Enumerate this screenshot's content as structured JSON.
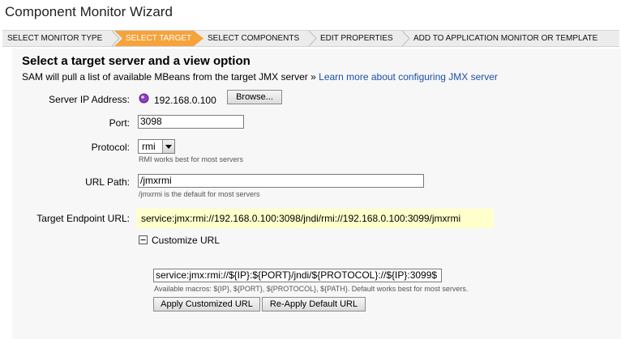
{
  "page": {
    "title": "Component Monitor Wizard"
  },
  "wizard": {
    "steps": [
      {
        "label": "SELECT MONITOR TYPE",
        "active": false
      },
      {
        "label": "SELECT TARGET",
        "active": true
      },
      {
        "label": "SELECT COMPONENTS",
        "active": false
      },
      {
        "label": "EDIT PROPERTIES",
        "active": false
      },
      {
        "label": "ADD TO APPLICATION MONITOR OR TEMPLATE",
        "active": false
      }
    ],
    "active_color": "#f5a33a"
  },
  "section": {
    "heading": "Select a target server and a view option",
    "description": "SAM will pull a list of available MBeans from the target JMX server »",
    "link": "Learn more about configuring JMX server"
  },
  "form": {
    "server_ip": {
      "label": "Server IP Address:",
      "value": "192.168.0.100",
      "browse_label": "Browse..."
    },
    "port": {
      "label": "Port:",
      "value": "3098"
    },
    "protocol": {
      "label": "Protocol:",
      "selected": "rmi",
      "hint": "RMI works best for most servers"
    },
    "url_path": {
      "label": "URL Path:",
      "value": "/jmxrmi",
      "hint": "/jmxrmi is the default for most servers"
    },
    "endpoint": {
      "label": "Target Endpoint URL:",
      "value": "service:jmx:rmi://192.168.0.100:3098/jndi/rmi://192.168.0.100:3099/jmxrmi"
    },
    "customize": {
      "toggle_label": "Customize URL",
      "value": "service:jmx:rmi://${IP}:${PORT}/jndi/${PROTOCOL}://${IP}:3099$",
      "hint": "Available macros: ${IP}, ${PORT}, ${PROTOCOL}, ${PATH}. Default works best for most servers.",
      "apply_label": "Apply Customized URL",
      "reapply_label": "Re-Apply Default URL"
    }
  },
  "colors": {
    "endpoint_bg": "#ffffcc",
    "link": "#1c4fa8",
    "panel_bg": "#f7f7f7"
  }
}
